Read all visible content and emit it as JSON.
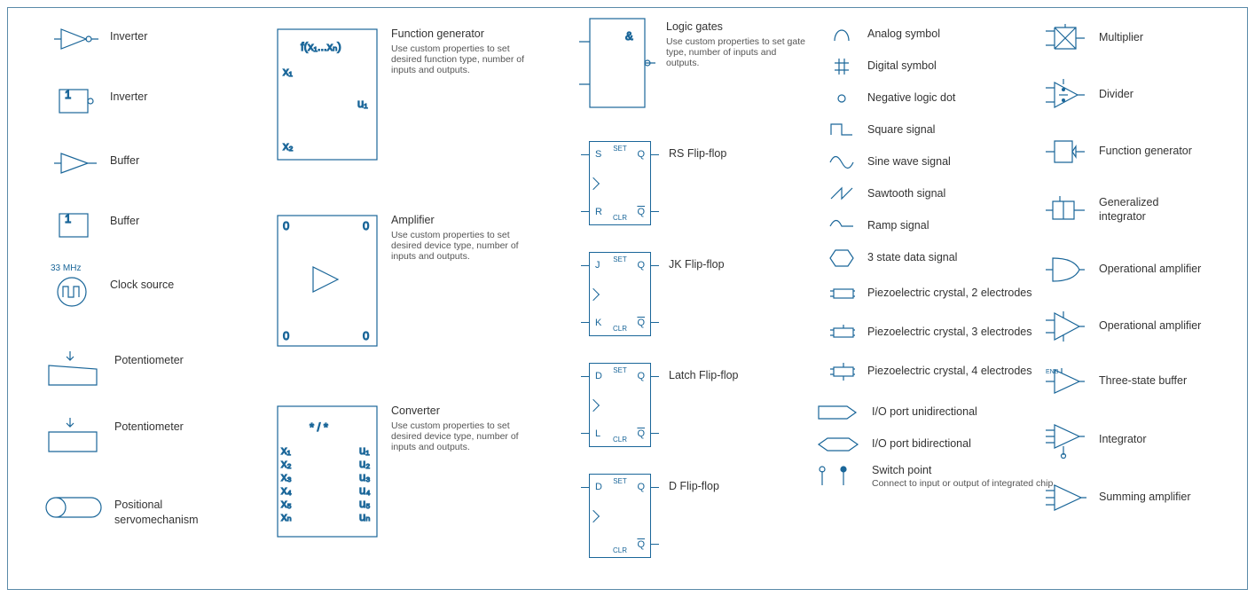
{
  "col1": [
    {
      "label": "Inverter"
    },
    {
      "label": "Inverter",
      "badge": "1"
    },
    {
      "label": "Buffer"
    },
    {
      "label": "Buffer",
      "badge": "1"
    },
    {
      "label": "Clock source",
      "freq": "33 MHz"
    },
    {
      "label": "Potentiometer"
    },
    {
      "label": "Potentiometer"
    },
    {
      "label": "Positional servomechanism"
    }
  ],
  "col2": [
    {
      "title": "Function generator",
      "sub": "Use custom properties to set desired function type, number of inputs and outputs.",
      "fn": "f(x₁...xₙ)",
      "x1": "x₁",
      "x2": "x₂",
      "u1": "u₁"
    },
    {
      "title": "Amplifier",
      "sub": "Use custom properties to set desired device type, number of inputs and outputs.",
      "corners": [
        "0",
        "0",
        "0",
        "0"
      ]
    },
    {
      "title": "Converter",
      "sub": "Use custom properties to set desired device type, number of inputs and outputs.",
      "center": "* / *",
      "left": [
        "x₁",
        "x₂",
        "x₃",
        "x₄",
        "x₅",
        "xₙ"
      ],
      "right": [
        "u₁",
        "u₂",
        "u₃",
        "u₄",
        "u₅",
        "uₙ"
      ]
    }
  ],
  "col3_top": {
    "title": "Logic gates",
    "sub": "Use custom properties to set gate type, number of inputs and outputs.",
    "sym": "&"
  },
  "flipflops": [
    {
      "name": "RS Flip-flop",
      "tl": "S",
      "bl": "R",
      "tr": "Q",
      "br": "Q"
    },
    {
      "name": "JK Flip-flop",
      "tl": "J",
      "bl": "K",
      "tr": "Q",
      "br": "Q"
    },
    {
      "name": "Latch Flip-flop",
      "tl": "D",
      "bl": "L",
      "tr": "Q",
      "br": "Q"
    },
    {
      "name": "D Flip-flop",
      "tl": "D",
      "bl": "",
      "tr": "Q",
      "br": "Q"
    }
  ],
  "col4": [
    {
      "label": "Analog symbol"
    },
    {
      "label": "Digital symbol"
    },
    {
      "label": "Negative logic dot"
    },
    {
      "label": "Square signal"
    },
    {
      "label": "Sine wave signal"
    },
    {
      "label": "Sawtooth signal"
    },
    {
      "label": "Ramp signal"
    },
    {
      "label": "3 state data signal"
    },
    {
      "label": "Piezoelectric crystal, 2 electrodes"
    },
    {
      "label": "Piezoelectric crystal, 3 electrodes"
    },
    {
      "label": "Piezoelectric crystal, 4 electrodes"
    },
    {
      "label": "I/O port unidirectional"
    },
    {
      "label": "I/O port bidirectional"
    },
    {
      "label": "Switch point",
      "sub": "Connect to input or output of integrated chip."
    }
  ],
  "col5": [
    {
      "label": "Multiplier"
    },
    {
      "label": "Divider"
    },
    {
      "label": "Function generator"
    },
    {
      "label": "Generalized integrator"
    },
    {
      "label": "Operational amplifier"
    },
    {
      "label": "Operational amplifier"
    },
    {
      "label": "Three-state buffer",
      "badge": "ENB"
    },
    {
      "label": "Integrator"
    },
    {
      "label": "Summing amplifier"
    }
  ]
}
